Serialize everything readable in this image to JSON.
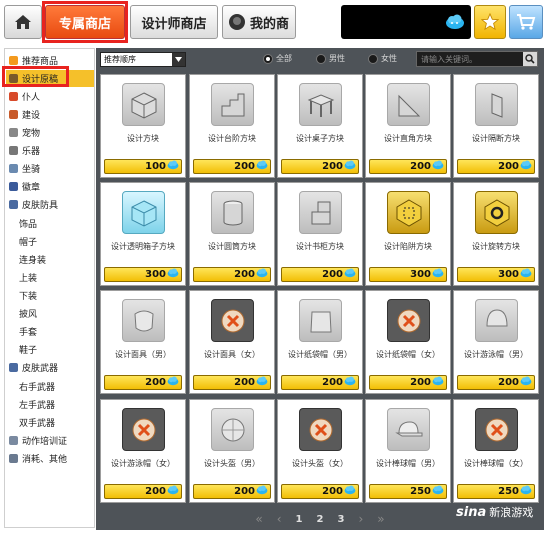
{
  "header": {
    "tabs": [
      {
        "label": "专属商店",
        "active": true
      },
      {
        "label": "设计师商店",
        "active": false
      },
      {
        "label": "我的商",
        "active": false
      }
    ]
  },
  "sidebar": {
    "items": [
      {
        "label": "推荐商品",
        "sub": false,
        "color": "#f39a1e"
      },
      {
        "label": "设计原稿",
        "sub": false,
        "color": "#7a5a2a",
        "active": true
      },
      {
        "label": "仆人",
        "sub": false,
        "color": "#d84a2a"
      },
      {
        "label": "建设",
        "sub": false,
        "color": "#c85a2a"
      },
      {
        "label": "宠物",
        "sub": false,
        "color": "#888888"
      },
      {
        "label": "乐器",
        "sub": false,
        "color": "#777777"
      },
      {
        "label": "坐骑",
        "sub": false,
        "color": "#6a8ab0"
      },
      {
        "label": "徽章",
        "sub": false,
        "color": "#3a5a9a"
      },
      {
        "label": "皮肤防具",
        "sub": false,
        "color": "#4a6aa0"
      },
      {
        "label": "饰品",
        "sub": true
      },
      {
        "label": "帽子",
        "sub": true
      },
      {
        "label": "连身装",
        "sub": true
      },
      {
        "label": "上装",
        "sub": true
      },
      {
        "label": "下装",
        "sub": true
      },
      {
        "label": "披风",
        "sub": true
      },
      {
        "label": "手套",
        "sub": true
      },
      {
        "label": "鞋子",
        "sub": true
      },
      {
        "label": "皮肤武器",
        "sub": false,
        "color": "#4a6aa0"
      },
      {
        "label": "右手武器",
        "sub": true
      },
      {
        "label": "左手武器",
        "sub": true
      },
      {
        "label": "双手武器",
        "sub": true
      },
      {
        "label": "动作培训证",
        "sub": false,
        "color": "#7a8aa0"
      },
      {
        "label": "消耗、其他",
        "sub": false,
        "color": "#6a7a90"
      }
    ]
  },
  "toolbar": {
    "sort_label": "推荐顺序",
    "filters": [
      {
        "label": "全部",
        "checked": true
      },
      {
        "label": "男性",
        "checked": false
      },
      {
        "label": "女性",
        "checked": false
      }
    ],
    "search_placeholder": "请输入关键词。"
  },
  "products": [
    {
      "name": "设计方块",
      "price": "100",
      "thumb": "cube"
    },
    {
      "name": "设计台阶方块",
      "price": "200",
      "thumb": "stair"
    },
    {
      "name": "设计桌子方块",
      "price": "200",
      "thumb": "table"
    },
    {
      "name": "设计直角方块",
      "price": "200",
      "thumb": "corner"
    },
    {
      "name": "设计隔断方块",
      "price": "200",
      "thumb": "partition"
    },
    {
      "name": "设计透明箱子方块",
      "price": "300",
      "thumb": "clear-cube"
    },
    {
      "name": "设计圆筒方块",
      "price": "200",
      "thumb": "cylinder"
    },
    {
      "name": "设计书柜方块",
      "price": "200",
      "thumb": "bookcase"
    },
    {
      "name": "设计陷阱方块",
      "price": "300",
      "thumb": "trap"
    },
    {
      "name": "设计旋转方块",
      "price": "300",
      "thumb": "rotate"
    },
    {
      "name": "设计面具（男）",
      "price": "200",
      "thumb": "mask"
    },
    {
      "name": "设计面具（女）",
      "price": "200",
      "thumb": "x-mark"
    },
    {
      "name": "设计纸袋帽（男）",
      "price": "200",
      "thumb": "paperbag"
    },
    {
      "name": "设计纸袋帽（女）",
      "price": "200",
      "thumb": "x-mark"
    },
    {
      "name": "设计游泳帽（男）",
      "price": "200",
      "thumb": "swimcap"
    },
    {
      "name": "设计游泳帽（女）",
      "price": "200",
      "thumb": "x-mark"
    },
    {
      "name": "设计头盔（男）",
      "price": "200",
      "thumb": "helmet"
    },
    {
      "name": "设计头盔（女）",
      "price": "200",
      "thumb": "x-mark"
    },
    {
      "name": "设计棒球帽（男）",
      "price": "250",
      "thumb": "cap"
    },
    {
      "name": "设计棒球帽（女）",
      "price": "250",
      "thumb": "x-mark"
    }
  ],
  "pagination": {
    "pages": [
      "1",
      "2",
      "3"
    ],
    "first_label": "«",
    "prev_label": "‹",
    "next_label": "›",
    "last_label": "»"
  },
  "watermark": {
    "logo": "sina",
    "text": "新浪游戏"
  },
  "colors": {
    "active_tab": "#ff6a2a",
    "price_bar": "#f5c518",
    "panel": "#4e5358",
    "highlight_box": "#e8231f"
  }
}
